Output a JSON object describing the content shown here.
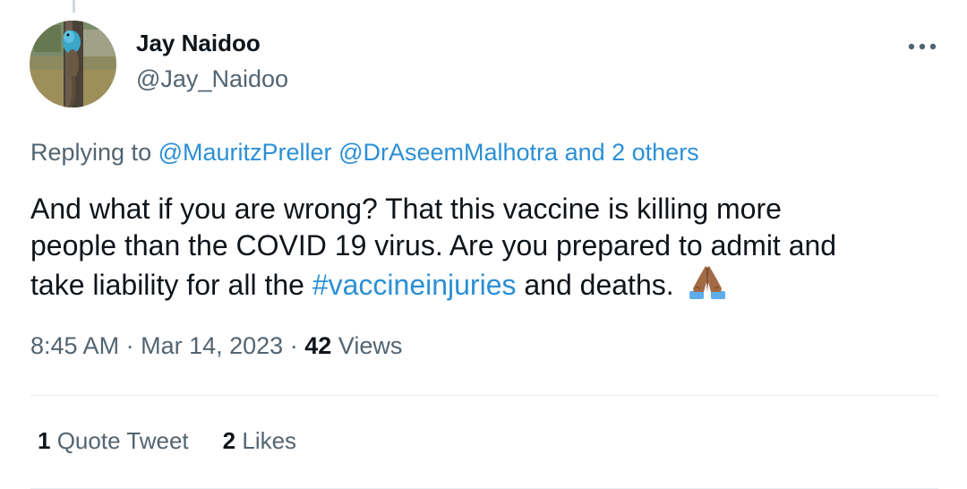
{
  "author": {
    "display_name": "Jay Naidoo",
    "handle": "@Jay_Naidoo",
    "avatar_icon": "lizard-avatar"
  },
  "replying": {
    "prefix": "Replying to",
    "mentions": [
      "@MauritzPreller",
      "@DrAseemMalhotra"
    ],
    "others": "and 2 others"
  },
  "tweet": {
    "line1": "And what if you are wrong? That this vaccine is killing more",
    "line2": "people than the COVID 19 virus. Are you prepared to admit and",
    "line3_before": "take liability for all the",
    "hashtag": "#vaccineinjuries",
    "line3_after": "and deaths.",
    "emoji": "folded-hands-medium-dark-skin"
  },
  "meta": {
    "time": "8:45 AM",
    "separator": "·",
    "date": "Mar 14, 2023",
    "views_count": "42",
    "views_label": "Views"
  },
  "stats": {
    "quote_count": "1",
    "quote_label": "Quote Tweet",
    "likes_count": "2",
    "likes_label": "Likes"
  },
  "colors": {
    "link": "#2b8fd6",
    "secondary_text": "#536471",
    "primary_text": "#0f1419",
    "divider": "#e6ecf0"
  }
}
